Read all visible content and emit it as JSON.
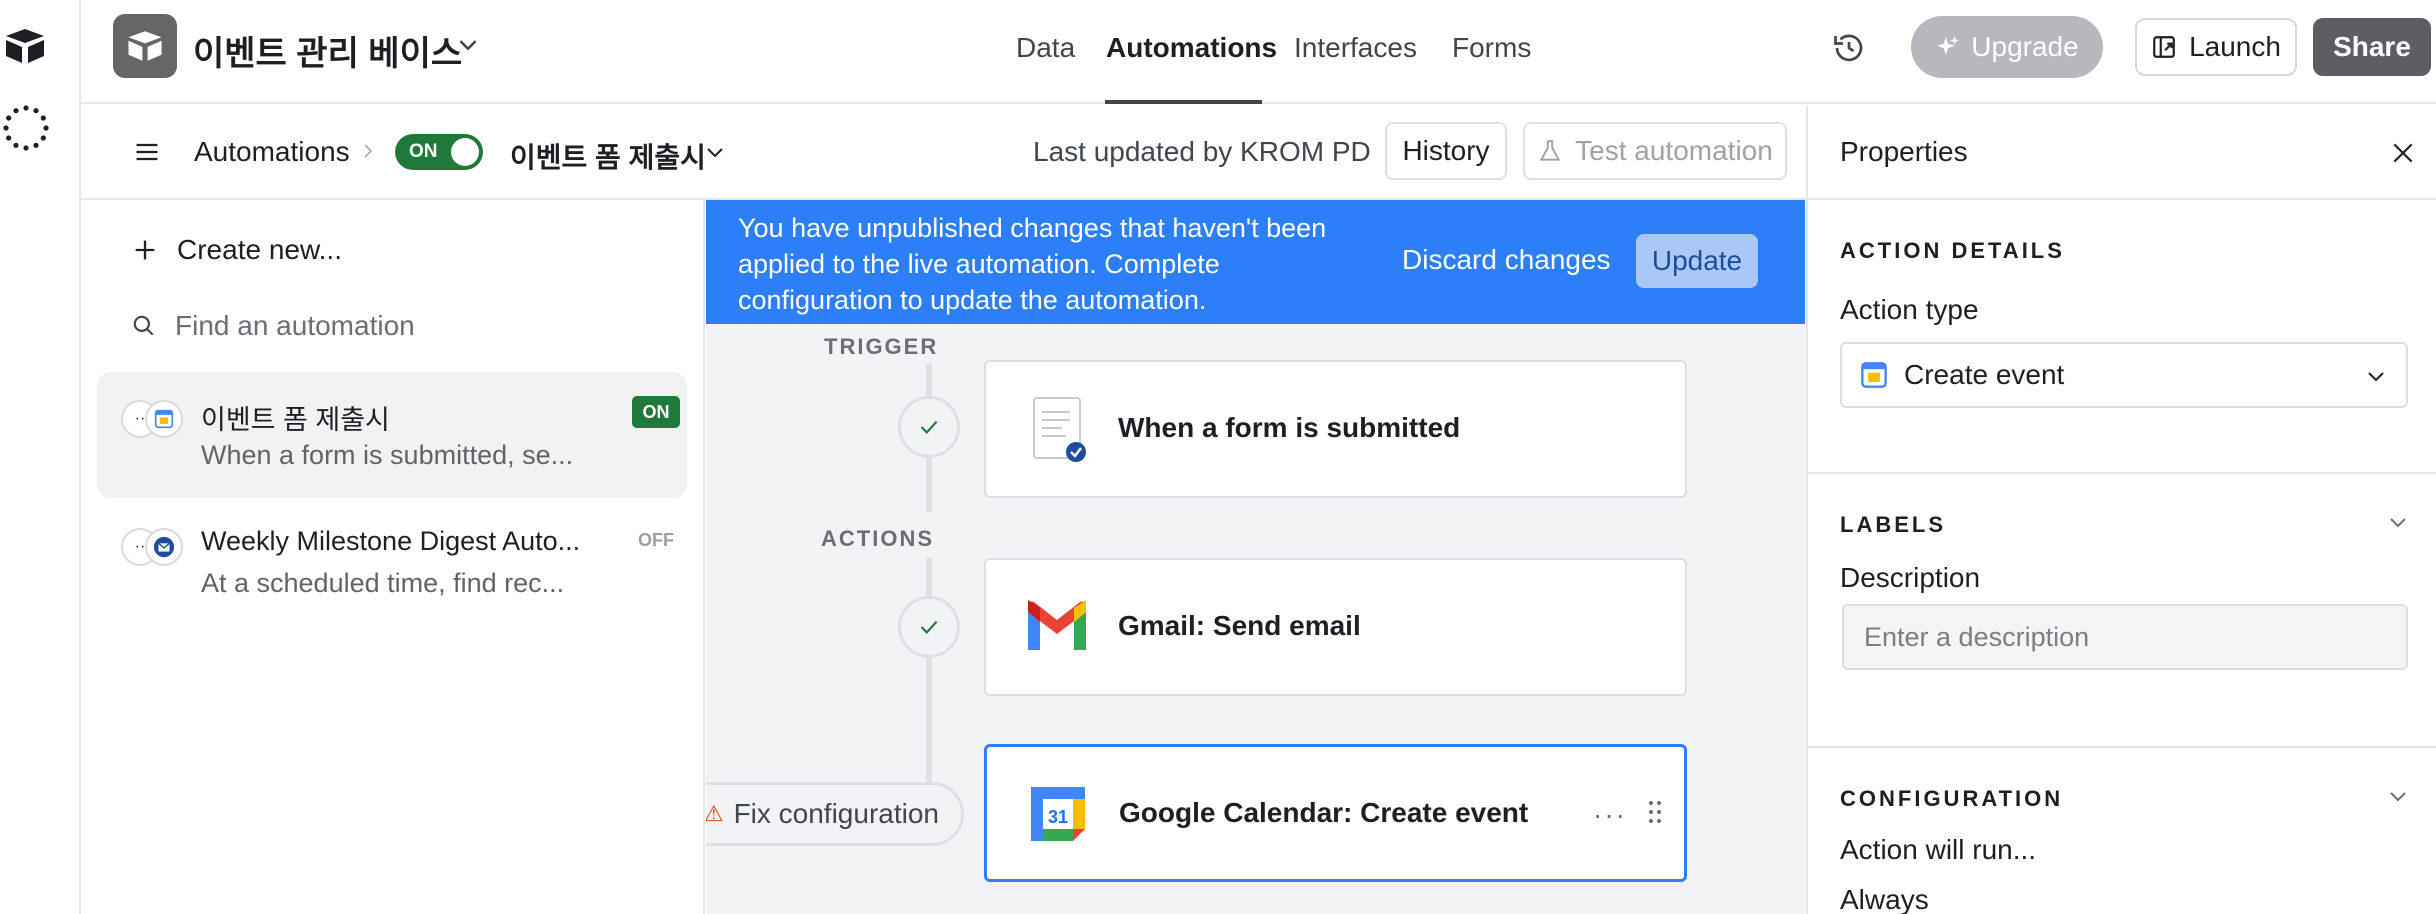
{
  "topbar": {
    "base_title": "이벤트 관리 베이스",
    "tabs": [
      "Data",
      "Automations",
      "Interfaces",
      "Forms"
    ],
    "upgrade_label": "Upgrade",
    "launch_label": "Launch",
    "share_label": "Share"
  },
  "subbar": {
    "breadcrumb": "Automations",
    "toggle_label": "ON",
    "automation_name": "이벤트 폼 제출시",
    "last_updated": "Last updated by KROM PD",
    "history_label": "History",
    "test_label": "Test automation"
  },
  "sidebar": {
    "create_new": "Create new...",
    "find_placeholder": "Find an automation",
    "items": [
      {
        "name": "이벤트 폼 제출시",
        "desc": "When a form is submitted, se...",
        "status": "ON"
      },
      {
        "name": "Weekly Milestone Digest Auto...",
        "desc": "At a scheduled time, find rec...",
        "status": "OFF"
      }
    ]
  },
  "canvas": {
    "banner_message": "You have unpublished changes that haven't been applied to the live automation. Complete configuration to update the automation.",
    "discard_label": "Discard changes",
    "update_label": "Update",
    "trigger_label": "TRIGGER",
    "actions_label": "ACTIONS",
    "steps": [
      {
        "title": "When a form is submitted",
        "icon": "form-icon"
      },
      {
        "title": "Gmail: Send email",
        "icon": "gmail-icon"
      },
      {
        "title": "Google Calendar: Create event",
        "icon": "google-calendar-icon"
      }
    ],
    "more_label": "···",
    "fix_label": "Fix configuration",
    "calendar_day": "31"
  },
  "properties": {
    "title": "Properties",
    "action_details": "ACTION DETAILS",
    "action_type_label": "Action type",
    "action_type_value": "Create event",
    "labels_section": "LABELS",
    "description_label": "Description",
    "description_placeholder": "Enter a description",
    "configuration_section": "CONFIGURATION",
    "action_will_run": "Action will run...",
    "always": "Always"
  },
  "colors": {
    "accent_blue": "#2d7ff9",
    "on_green": "#1f7a3a",
    "share_gray": "#5c5e64"
  }
}
